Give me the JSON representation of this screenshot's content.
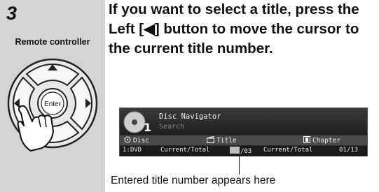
{
  "side": {
    "step_number": "3",
    "label": "Remote controller",
    "enter_label": "Enter"
  },
  "instruction": {
    "text": "If you want to select a title, press the Left [◀] button to move the cursor to the current title number."
  },
  "osd": {
    "title": "Disc Navigator",
    "subtitle": "Search",
    "disc_badge": "1",
    "headers": {
      "disc": "Disc",
      "title": "Title",
      "chapter": "Chapter"
    },
    "row": {
      "disc_value": "1:DVD",
      "title_label": "Current/Total",
      "title_total": "/03",
      "chapter_label": "Current/Total",
      "chapter_value": "01/13"
    }
  },
  "caption": "Entered title number appears here",
  "colors": {
    "side_panel": "#d4d4d4",
    "osd_background": "#2a2a2a",
    "osd_header": "#4a4a4a"
  }
}
